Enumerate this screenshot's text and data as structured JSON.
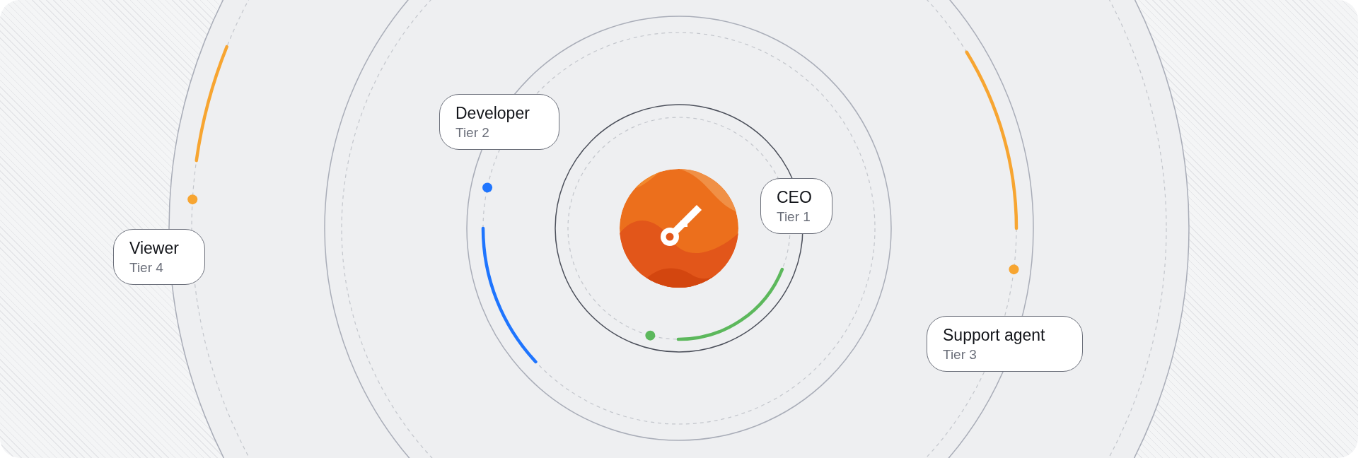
{
  "roles": [
    {
      "name": "CEO",
      "tier": "Tier 1",
      "color": "#5cb85c"
    },
    {
      "name": "Developer",
      "tier": "Tier 2",
      "color": "#1f75fe"
    },
    {
      "name": "Support agent",
      "tier": "Tier 3",
      "color": "#f7a531"
    },
    {
      "name": "Viewer",
      "tier": "Tier 4",
      "color": "#f7a531"
    }
  ]
}
